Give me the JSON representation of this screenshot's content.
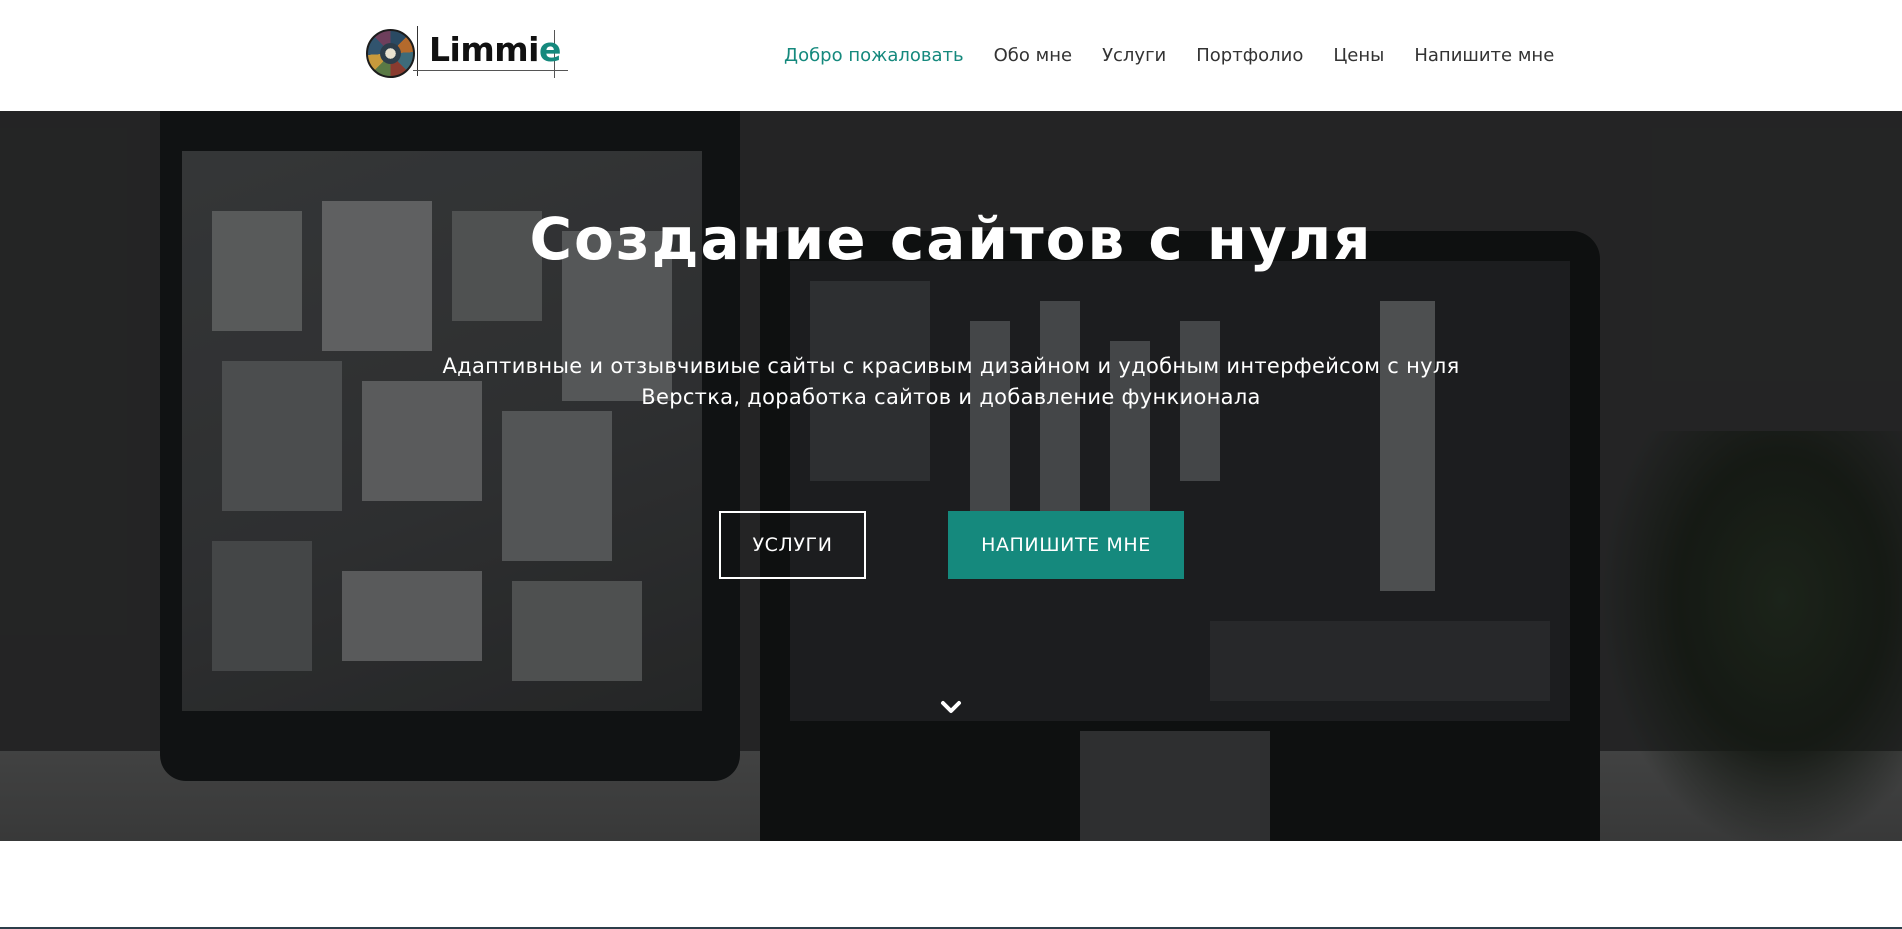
{
  "header": {
    "logo": {
      "text_main": "Limmi",
      "text_accent": "e"
    },
    "nav": [
      {
        "label": "Добро пожаловать",
        "active": true
      },
      {
        "label": "Обо мне",
        "active": false
      },
      {
        "label": "Услуги",
        "active": false
      },
      {
        "label": "Портфолио",
        "active": false
      },
      {
        "label": "Цены",
        "active": false
      },
      {
        "label": "Напишите мне",
        "active": false
      }
    ]
  },
  "hero": {
    "title": "Создание сайтов с нуля",
    "subtitle_line1": "Адаптивные и отзывчивиые сайты с красивым дизайном и удобным интерфейсом с нуля",
    "subtitle_line2": "Верстка, доработка сайтов и добавление функионала",
    "button_primary": "УСЛУГИ",
    "button_secondary": "НАПИШИТЕ МНЕ",
    "scroll_icon": "chevron-down-icon"
  },
  "colors": {
    "accent": "#15897d",
    "nav_text": "#333333",
    "white": "#ffffff"
  }
}
